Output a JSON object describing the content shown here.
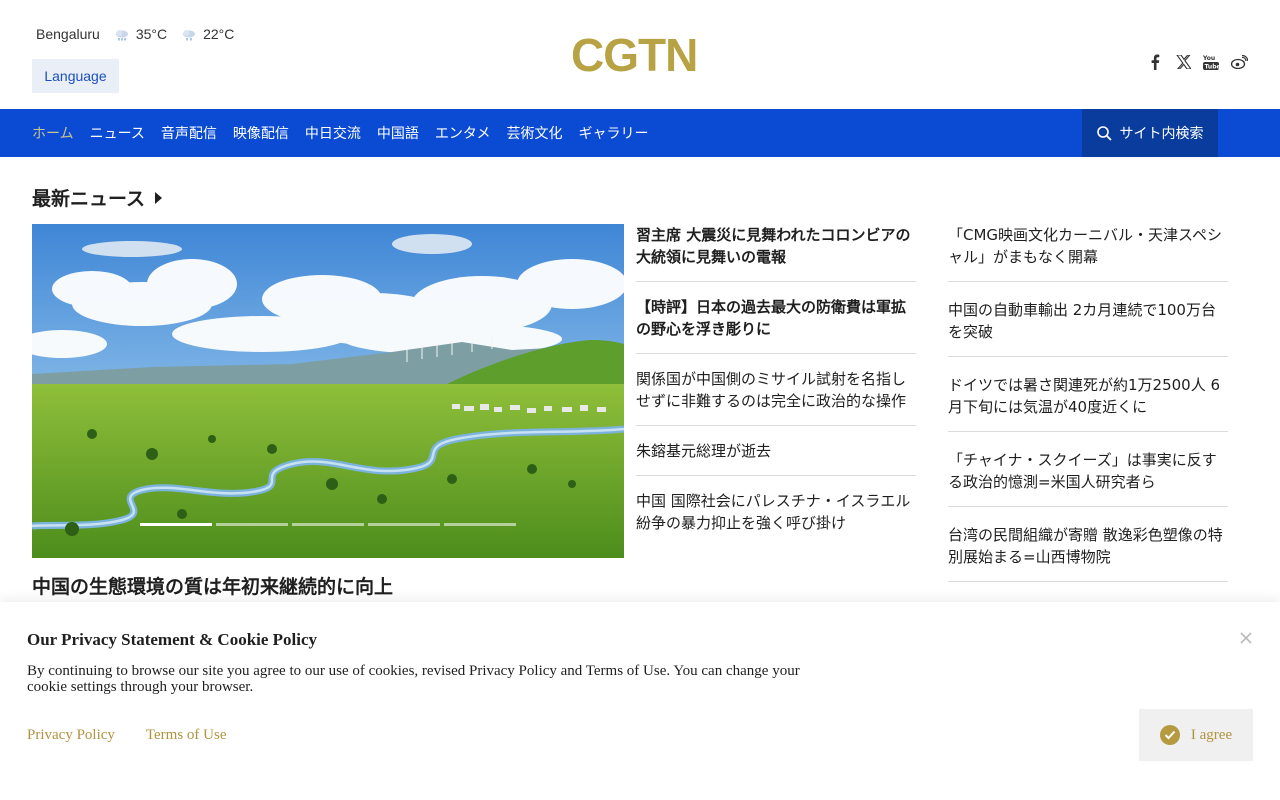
{
  "weather": {
    "city": "Bengaluru",
    "temp_high": "35°C",
    "temp_low": "22°C"
  },
  "language_button": "Language",
  "logo": "CGTN",
  "socials": [
    "facebook-icon",
    "x-icon",
    "youtube-icon",
    "weibo-icon"
  ],
  "nav": {
    "items": [
      "ホーム",
      "ニュース",
      "音声配信",
      "映像配信",
      "中日交流",
      "中国語",
      "エンタメ",
      "芸術文化",
      "ギャラリー"
    ],
    "active": 0,
    "search_label": "サイト内検索"
  },
  "section": {
    "title": "最新ニュース"
  },
  "hero": {
    "caption": "中国の生態環境の質は年初来継続的に向上",
    "slides": 5,
    "active_slide": 0
  },
  "news_middle": [
    {
      "text": "習主席 大震災に見舞われたコロンビアの大統領に見舞いの電報",
      "bold": true
    },
    {
      "text": "【時評】日本の過去最大の防衛費は軍拡の野心を浮き彫りに",
      "bold": true
    },
    {
      "text": "関係国が中国側のミサイル試射を名指しせずに非難するのは完全に政治的な操作",
      "bold": false
    },
    {
      "text": "朱鎔基元総理が逝去",
      "bold": false
    },
    {
      "text": "中国 国際社会にパレスチナ・イスラエル紛争の暴力抑止を強く呼び掛け",
      "bold": false
    }
  ],
  "news_right": [
    {
      "text": "「CMG映画文化カーニバル・天津スペシャル」がまもなく開幕"
    },
    {
      "text": "中国の自動車輸出 2カ月連続で100万台を突破"
    },
    {
      "text": "ドイツでは暑さ関連死が約1万2500人 6月下旬には気温が40度近くに"
    },
    {
      "text": "「チャイナ・スクイーズ」は事実に反する政治的憶測=米国人研究者ら"
    },
    {
      "text": "台湾の民間組織が寄贈 散逸彩色塑像の特別展始まる=山西博物院"
    }
  ],
  "cookie": {
    "title": "Our Privacy Statement & Cookie Policy",
    "text": "By continuing to browse our site you agree to our use of cookies, revised Privacy Policy and Terms of Use. You can change your cookie settings through your browser.",
    "privacy_link": "Privacy Policy",
    "terms_link": "Terms of Use",
    "agree_label": "I agree"
  },
  "colors": {
    "nav": "#0b4bd4",
    "search": "#0a3c9e",
    "logo": "#b8a344",
    "gold": "#b0933f"
  }
}
